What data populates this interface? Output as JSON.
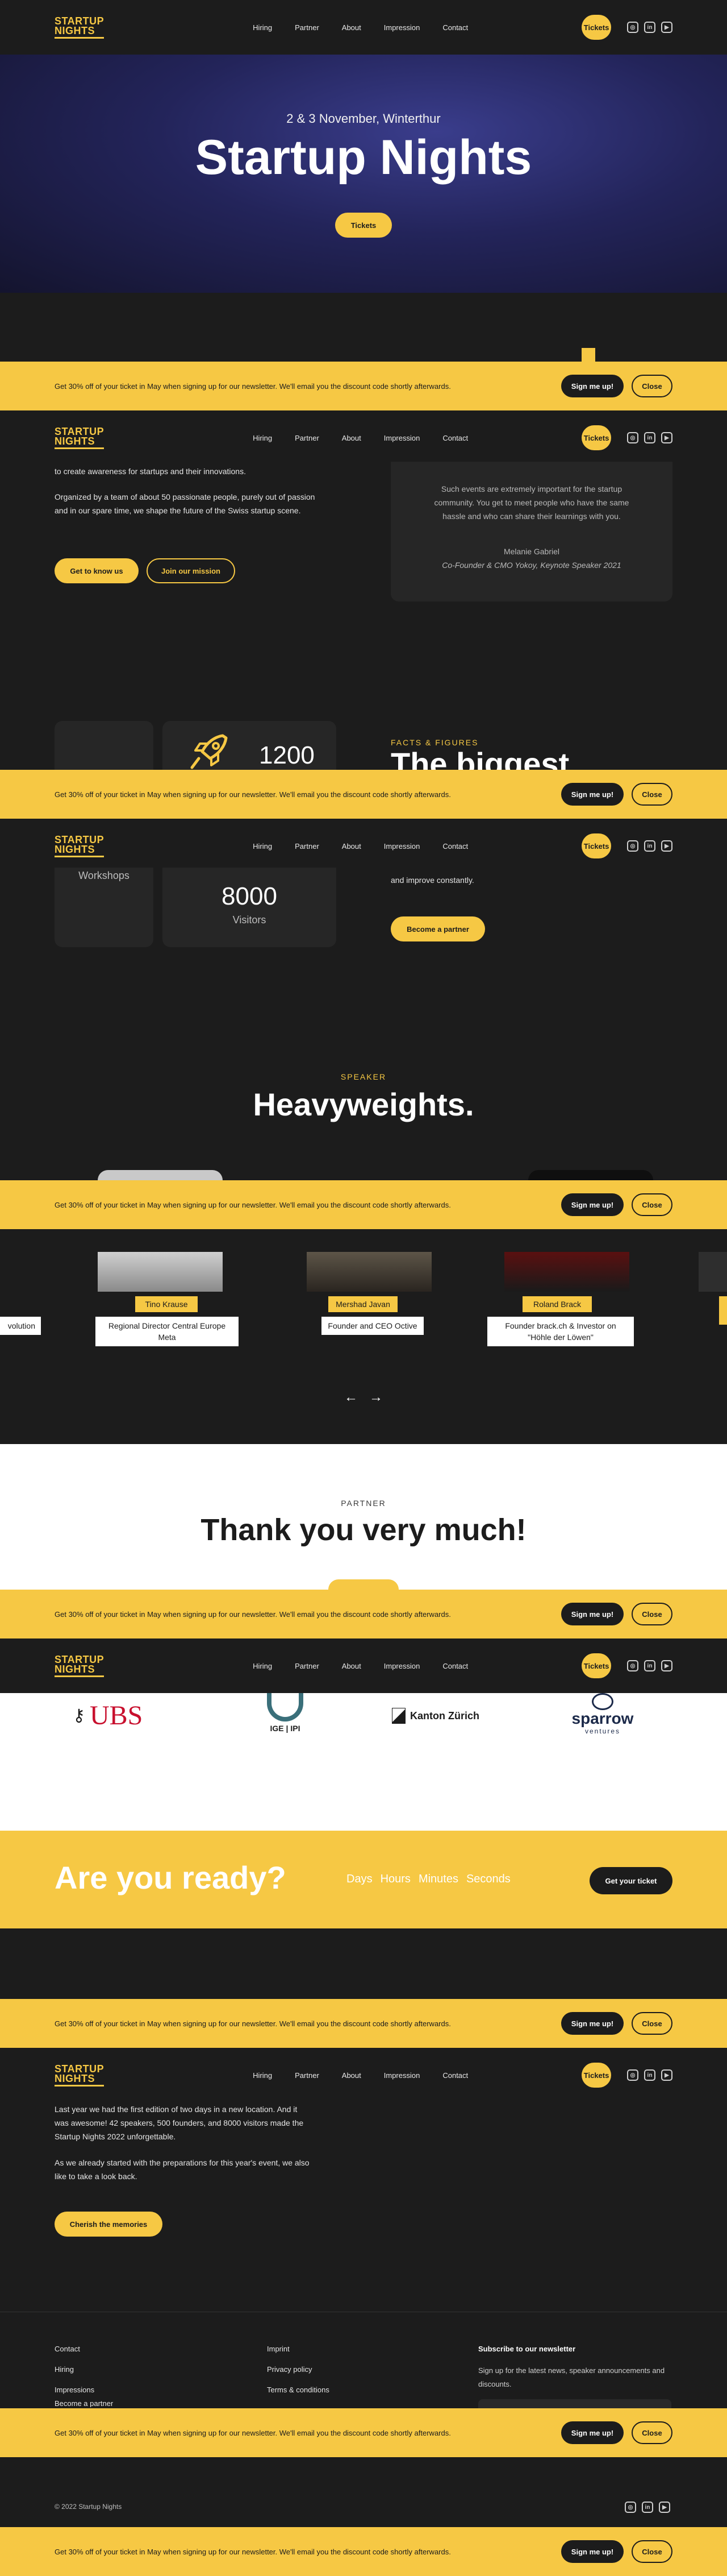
{
  "brand": {
    "logo_line1": "STARTUP",
    "logo_line2": "NIGHTS",
    "accent": "#f6c844",
    "dark": "#1c1c1c"
  },
  "nav": {
    "items": [
      "Hiring",
      "Partner",
      "About",
      "Impression",
      "Contact"
    ],
    "tickets": "Tickets",
    "socials": [
      "instagram-icon",
      "linkedin-icon",
      "youtube-icon"
    ]
  },
  "newsletter_bar": {
    "text": "Get 30% off of your ticket in May when signing up for our newsletter. We'll email you the discount code shortly afterwards.",
    "sign_label": "Sign me up!",
    "close_label": "Close"
  },
  "hero": {
    "date": "2 & 3 November, Winterthur",
    "title": "Startup Nights",
    "cta": "Tickets"
  },
  "about": {
    "line1": "to create awareness for startups and their innovations.",
    "paragraph": "Organized by a team of about 50 passionate people, purely out of passion and in our spare time, we shape the future of the Swiss startup scene.",
    "btn_primary": "Get to know us",
    "btn_secondary": "Join our mission",
    "quote": "Such events are extremely important for the startup community. You get to meet people who have the same hassle and who can share their learnings with you.",
    "quote_author": "Melanie Gabriel",
    "quote_role": "Co-Founder & CMO Yokoy, Keynote Speaker 2021"
  },
  "facts": {
    "eyebrow": "FACTS & FIGURES",
    "title_partial": "The biggest",
    "stat1_value": "1200",
    "stat2_label": "Workshops",
    "stat3_value": "8000",
    "stat3_label": "Visitors",
    "text_tail": "and improve constantly.",
    "cta": "Become a partner"
  },
  "speakers": {
    "eyebrow": "SPEAKER",
    "title": "Heavyweights.",
    "items": [
      {
        "role": "volution"
      },
      {
        "name": "Tino Krause",
        "role": "Regional Director Central Europe Meta"
      },
      {
        "name": "Mershad Javan",
        "role": "Founder and CEO Octive"
      },
      {
        "name": "Roland Brack",
        "role": "Founder brack.ch & Investor on \"Höhle der Löwen\""
      }
    ],
    "prev": "←",
    "next": "→"
  },
  "partner": {
    "eyebrow": "PARTNER",
    "title": "Thank you very much!",
    "logos": [
      "UBS",
      "IGE | IPI",
      "Kanton Zürich",
      "sparrow",
      "ventures"
    ]
  },
  "countdown": {
    "title": "Are you ready?",
    "units": [
      "Days",
      "Hours",
      "Minutes",
      "Seconds"
    ],
    "cta": "Get your ticket"
  },
  "memories": {
    "p1": "Last year we had the first edition of two days in a new location. And it was awesome! 42 speakers, 500 founders, and 8000 visitors made the Startup Nights 2022 unforgettable.",
    "p2": "As we already started with the preparations for this year's event, we also like to take a look back.",
    "cta": "Cherish the memories"
  },
  "footer": {
    "col1": [
      "Contact",
      "Hiring",
      "Impressions",
      "Become a partner"
    ],
    "col2": [
      "Imprint",
      "Privacy policy",
      "Terms & conditions"
    ],
    "subscribe_title": "Subscribe to our newsletter",
    "subscribe_text": "Sign up for the latest news, speaker announcements and discounts.",
    "copyright": "© 2022 Startup Nights"
  }
}
